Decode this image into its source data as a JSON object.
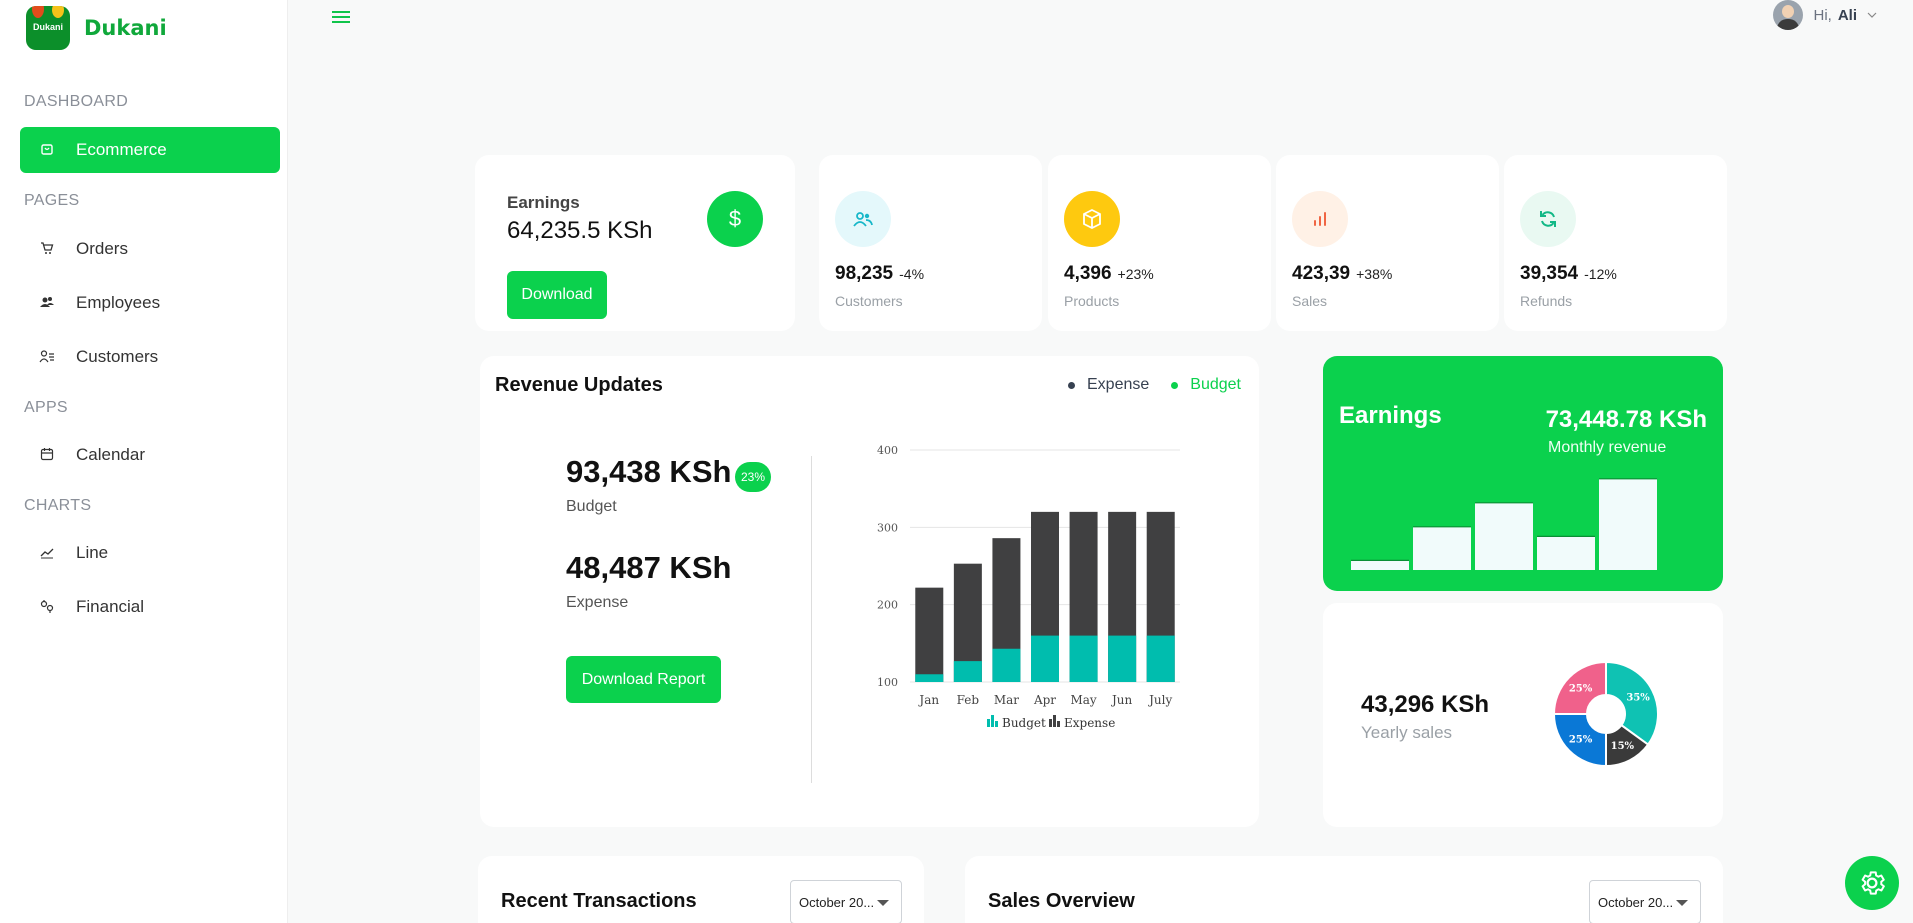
{
  "brand": {
    "name": "Dukani",
    "badge_text": "Dukani"
  },
  "sidebar": {
    "sections": [
      {
        "title": "DASHBOARD",
        "items": [
          {
            "label": "Ecommerce",
            "icon": "shopping-bag-icon",
            "active": true
          }
        ]
      },
      {
        "title": "PAGES",
        "items": [
          {
            "label": "Orders",
            "icon": "cart-icon"
          },
          {
            "label": "Employees",
            "icon": "users-group-icon"
          },
          {
            "label": "Customers",
            "icon": "user-list-icon"
          }
        ]
      },
      {
        "title": "APPS",
        "items": [
          {
            "label": "Calendar",
            "icon": "calendar-icon"
          }
        ]
      },
      {
        "title": "CHARTS",
        "items": [
          {
            "label": "Line",
            "icon": "line-chart-icon"
          },
          {
            "label": "Financial",
            "icon": "financial-icon"
          }
        ]
      }
    ]
  },
  "header": {
    "greeting": "Hi,",
    "user_name": "Ali"
  },
  "earnings_card": {
    "title": "Earnings",
    "amount": "64,235.5 KSh",
    "button": "Download",
    "icon": "dollar-icon"
  },
  "stats": [
    {
      "value": "98,235",
      "change": "-4%",
      "label": "Customers",
      "icon": "users-icon",
      "bg": "#e4f8fb",
      "fg": "#17b7c9"
    },
    {
      "value": "4,396",
      "change": "+23%",
      "label": "Products",
      "icon": "box-icon",
      "bg": "#fec90f",
      "fg": "#ffffff"
    },
    {
      "value": "423,39",
      "change": "+38%",
      "label": "Sales",
      "icon": "bar-chart-icon",
      "bg": "#fff1e6",
      "fg": "#f06543"
    },
    {
      "value": "39,354",
      "change": "-12%",
      "label": "Refunds",
      "icon": "refresh-icon",
      "bg": "#e9f9f2",
      "fg": "#12b886"
    }
  ],
  "revenue": {
    "title": "Revenue Updates",
    "legend": [
      {
        "label": "Expense",
        "color": "#374151"
      },
      {
        "label": "Budget",
        "color": "#0bd14d"
      }
    ],
    "budget_value": "93,438 KSh",
    "budget_label": "Budget",
    "budget_badge": "23%",
    "expense_value": "48,487 KSh",
    "expense_label": "Expense",
    "button": "Download Report"
  },
  "chart_data": [
    {
      "type": "bar",
      "stacked": true,
      "categories": [
        "Jan",
        "Feb",
        "Mar",
        "Apr",
        "May",
        "Jun",
        "July"
      ],
      "series": [
        {
          "name": "Budget",
          "color": "#00bdae",
          "values": [
            110,
            127,
            143,
            160,
            160,
            160,
            160
          ]
        },
        {
          "name": "Expense",
          "color": "#404041",
          "values": [
            222,
            253,
            286,
            320,
            320,
            320,
            320
          ]
        }
      ],
      "ylim": [
        100,
        400
      ],
      "yticks": [
        100,
        200,
        300,
        400
      ],
      "grid": true,
      "legend": "bottom"
    },
    {
      "type": "bar",
      "values": [
        1,
        4.5,
        7,
        3.5,
        9.5
      ],
      "ylim": [
        0,
        10
      ],
      "grid": false
    },
    {
      "type": "pie",
      "donut": true,
      "slices": [
        {
          "label": "35%",
          "value": 35,
          "color": "#0fc2b3"
        },
        {
          "label": "15%",
          "value": 15,
          "color": "#3a3a3a"
        },
        {
          "label": "25%",
          "value": 25,
          "color": "#0a78d6"
        },
        {
          "label": "25%",
          "value": 25,
          "color": "#f0618b"
        }
      ]
    }
  ],
  "monthly": {
    "title": "Earnings",
    "amount": "73,448.78 KSh",
    "subtitle": "Monthly revenue"
  },
  "yearly": {
    "amount": "43,296 KSh",
    "label": "Yearly sales"
  },
  "transactions": {
    "title": "Recent Transactions",
    "dropdown": "October 20..."
  },
  "sales_overview": {
    "title": "Sales Overview",
    "dropdown": "October 20..."
  },
  "settings": {
    "icon": "gear-icon"
  }
}
